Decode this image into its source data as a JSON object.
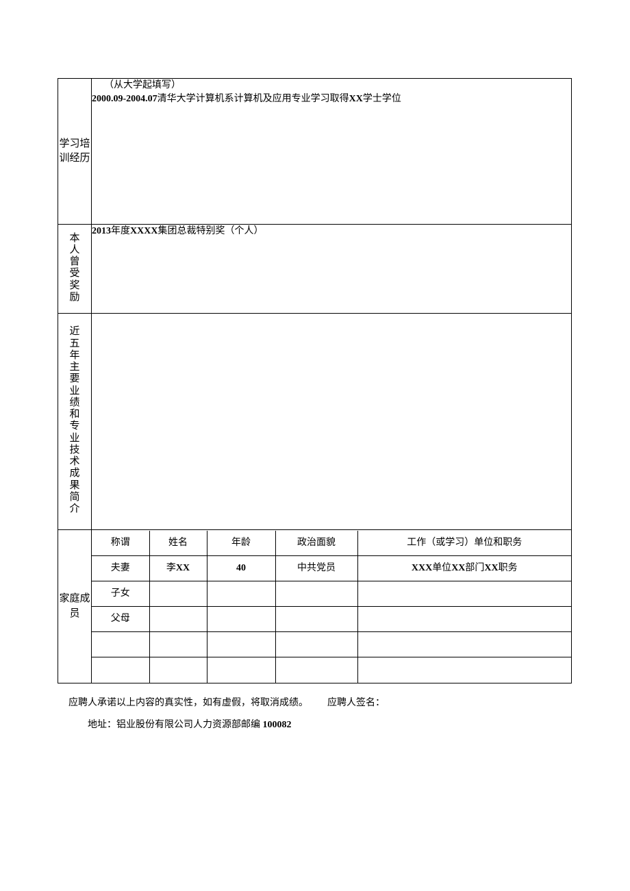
{
  "sections": {
    "education": {
      "label": "学习培训经历",
      "note": "（从大学起填写）",
      "line_prefix": "2000.09-2004.07",
      "line_body": "清华大学计算机系计算机及应用专业学习取得",
      "line_deg_prefix": "XX",
      "line_suffix": "学士学位"
    },
    "awards": {
      "label": "本人曾受奖励",
      "line_year": "2013",
      "line_mid": "年度",
      "line_org": "XXXX",
      "line_tail": "集团总裁特别奖（个人）"
    },
    "achievements": {
      "label": "近五年主要业绩和专业技术成果简介"
    },
    "family": {
      "label": "家庭成员",
      "headers": {
        "relation": "称谓",
        "name": "姓名",
        "age": "年龄",
        "political": "政治面貌",
        "work": "工作（或学习）单位和职务"
      },
      "rows": [
        {
          "relation": "夫妻",
          "name_prefix": "李",
          "name_bold": "XX",
          "age": "40",
          "political": "中共党员",
          "work_a": "XXX",
          "work_b": "单位",
          "work_c": "XX",
          "work_d": "部门",
          "work_e": "XX",
          "work_f": "职务"
        },
        {
          "relation": "子女",
          "name_prefix": "",
          "name_bold": "",
          "age": "",
          "political": "",
          "work_a": "",
          "work_b": "",
          "work_c": "",
          "work_d": "",
          "work_e": "",
          "work_f": ""
        },
        {
          "relation": "父母",
          "name_prefix": "",
          "name_bold": "",
          "age": "",
          "political": "",
          "work_a": "",
          "work_b": "",
          "work_c": "",
          "work_d": "",
          "work_e": "",
          "work_f": ""
        },
        {
          "relation": "",
          "name_prefix": "",
          "name_bold": "",
          "age": "",
          "political": "",
          "work_a": "",
          "work_b": "",
          "work_c": "",
          "work_d": "",
          "work_e": "",
          "work_f": ""
        },
        {
          "relation": "",
          "name_prefix": "",
          "name_bold": "",
          "age": "",
          "political": "",
          "work_a": "",
          "work_b": "",
          "work_c": "",
          "work_d": "",
          "work_e": "",
          "work_f": ""
        }
      ]
    }
  },
  "footer": {
    "declaration": "应聘人承诺以上内容的真实性，如有虚假，将取消成绩。",
    "signature_label": "应聘人签名：",
    "address_label": "地址：铝业股份有限公司人力资源部邮编",
    "postcode": "100082"
  }
}
